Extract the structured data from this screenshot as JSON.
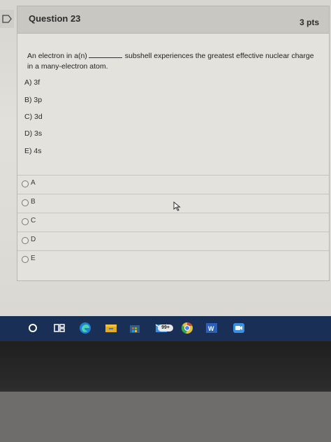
{
  "question": {
    "title": "Question 23",
    "points": "3 pts",
    "text_before_blank": "An electron in a(n)",
    "text_after_blank": "subshell experiences the greatest effective nuclear charge in a many-electron atom.",
    "choices": [
      "A) 3f",
      "B) 3p",
      "C) 3d",
      "D) 3s",
      "E) 4s"
    ]
  },
  "options": [
    {
      "label": "A",
      "selected": false
    },
    {
      "label": "B",
      "selected": false
    },
    {
      "label": "C",
      "selected": false
    },
    {
      "label": "D",
      "selected": false
    },
    {
      "label": "E",
      "selected": false
    }
  ],
  "taskbar": {
    "icons": [
      "search-icon",
      "task-view-icon",
      "edge-icon",
      "file-explorer-icon",
      "store-icon",
      "mail-icon",
      "chrome-icon",
      "word-icon",
      "zoom-icon"
    ],
    "mail_badge": "99+",
    "colors": {
      "background": "#1a2f55",
      "accent": "#3b8fe0"
    }
  }
}
